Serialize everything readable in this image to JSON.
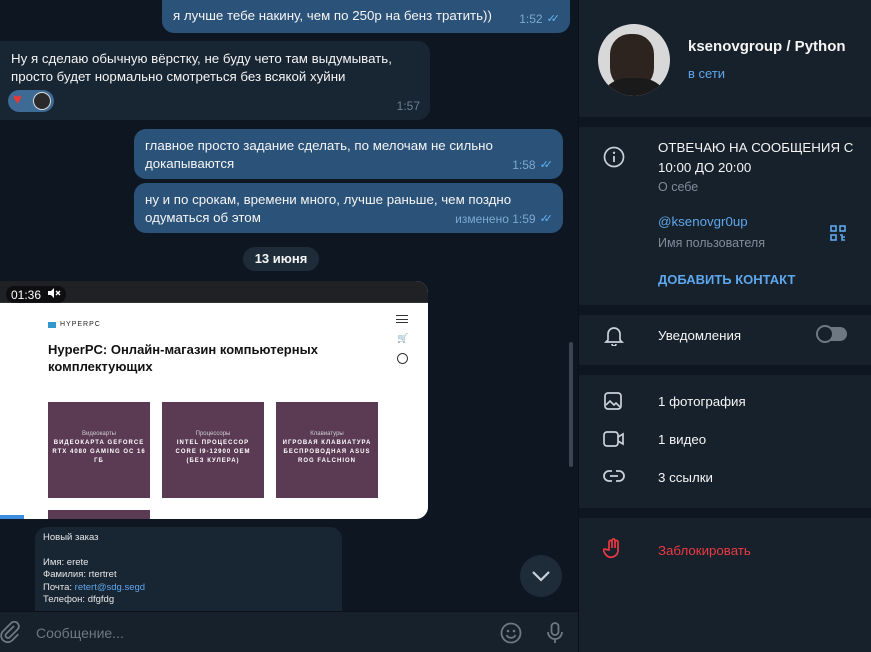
{
  "messages": [
    {
      "text": "я лучше тебе накину, чем по 250р на бенз тратить))",
      "time": "1:52"
    },
    {
      "text": "Ну я сделаю обычную вёрстку, не буду чето там выдумывать, просто будет нормально смотреться без всякой хуйни",
      "time": "1:57"
    },
    {
      "text": "главное просто задание сделать, по мелочам не сильно докапываются",
      "time": "1:58"
    },
    {
      "text": "ну и по срокам, времени много, лучше раньше, чем поздно одуматься об этом",
      "time": "изменено 1:59"
    }
  ],
  "date_separator": "13 июня",
  "video": {
    "duration": "01:36",
    "site_logo": "HYPERPC",
    "page_title": "HyperPC: Онлайн-магазин компьютерных комплектующих",
    "cards": [
      {
        "category": "Видеокарты",
        "name": "ВИДЕОКАРТА GEFORCE RTX 4080 GAMING OC 16 ГБ"
      },
      {
        "category": "Процессоры",
        "name": "INTEL ПРОЦЕССОР CORE I9-12900 OEM (БЕЗ КУЛЕРА)"
      },
      {
        "category": "Клавиатуры",
        "name": "ИГРОВАЯ КЛАВИАТУРА БЕСПРОВОДНАЯ ASUS ROG FALCHION"
      }
    ]
  },
  "order": {
    "title": "Новый заказ",
    "name": "Имя: erete",
    "surname": "Фамилия: rtertret",
    "email_label": "Почта: ",
    "email": "retert@sdg.segd",
    "phone": "Телефон: dfgfdg"
  },
  "composer": {
    "placeholder": "Сообщение..."
  },
  "panel": {
    "name": "ksenovgroup / Python",
    "status": "в сети",
    "about": "ОТВЕЧАЮ НА СООБЩЕНИЯ С 10:00 ДО 20:00",
    "about_label": "О себе",
    "username": "@ksenovgr0up",
    "username_label": "Имя пользователя",
    "add_contact": "ДОБАВИТЬ КОНТАКТ",
    "notifications": "Уведомления",
    "notifications_on": false,
    "photos": "1 фотография",
    "videos": "1 видео",
    "links": "3 ссылки",
    "block": "Заблокировать"
  },
  "colors": {
    "accent": "#5fa7ec",
    "outgoing": "#2b5278",
    "incoming": "#182533",
    "danger": "#ec3942"
  }
}
